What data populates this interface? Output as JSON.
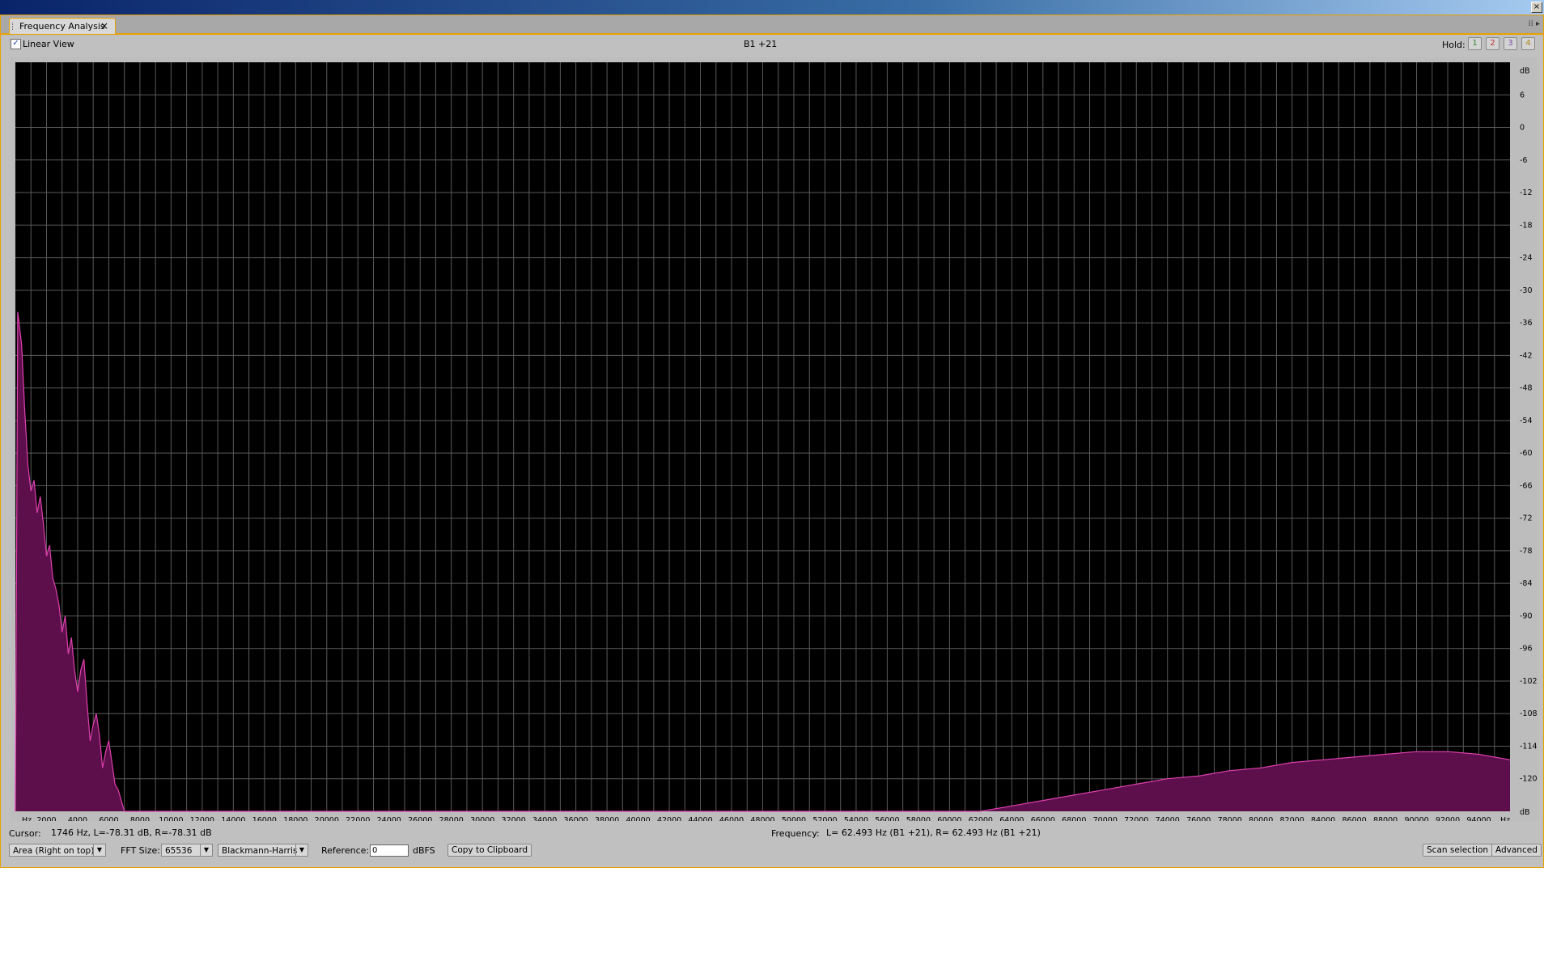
{
  "window": {
    "close_glyph": "×"
  },
  "tab": {
    "label": "Frequency Analysis",
    "close": "×",
    "strip_glyphs": "⁞⁞ ▸"
  },
  "toolbar": {
    "linear_view_checked": "✓",
    "linear_view_label": "Linear View",
    "center_label": "B1 +21",
    "hold_label": "Hold:",
    "hold_buttons": [
      {
        "label": "1",
        "color": "#3a8a3a"
      },
      {
        "label": "2",
        "color": "#c03030"
      },
      {
        "label": "3",
        "color": "#7a4aa0"
      },
      {
        "label": "4",
        "color": "#b08a20"
      }
    ]
  },
  "status": {
    "cursor_label": "Cursor:",
    "cursor_value": "1746 Hz, L=-78.31 dB, R=-78.31 dB",
    "frequency_label": "Frequency:",
    "frequency_value": "L= 62.493 Hz (B1 +21), R= 62.493 Hz (B1 +21)"
  },
  "controls": {
    "graph_mode": "Area (Right on top)",
    "fft_label": "FFT Size:",
    "fft_value": "65536",
    "window_value": "Blackmann-Harris",
    "reference_label": "Reference:",
    "reference_value": "0",
    "reference_unit": "dBFS",
    "copy_button": "Copy to Clipboard",
    "scan_button": "Scan selection",
    "advanced_button": "Advanced",
    "dropdown_arrow": "▼"
  },
  "chart_data": {
    "type": "area",
    "xlabel": "Hz",
    "ylabel": "dB",
    "xlim": [
      0,
      96000
    ],
    "ylim": [
      -126,
      12
    ],
    "x_ticks": [
      "2000",
      "4000",
      "6000",
      "8000",
      "10000",
      "12000",
      "14000",
      "16000",
      "18000",
      "20000",
      "22000",
      "24000",
      "26000",
      "28000",
      "30000",
      "32000",
      "34000",
      "36000",
      "38000",
      "40000",
      "42000",
      "44000",
      "46000",
      "48000",
      "50000",
      "52000",
      "54000",
      "56000",
      "58000",
      "60000",
      "62000",
      "64000",
      "66000",
      "68000",
      "70000",
      "72000",
      "74000",
      "76000",
      "78000",
      "80000",
      "82000",
      "84000",
      "86000",
      "88000",
      "90000",
      "92000",
      "94000"
    ],
    "x_tick_values": [
      2000,
      4000,
      6000,
      8000,
      10000,
      12000,
      14000,
      16000,
      18000,
      20000,
      22000,
      24000,
      26000,
      28000,
      30000,
      32000,
      34000,
      36000,
      38000,
      40000,
      42000,
      44000,
      46000,
      48000,
      50000,
      52000,
      54000,
      56000,
      58000,
      60000,
      62000,
      64000,
      66000,
      68000,
      70000,
      72000,
      74000,
      76000,
      78000,
      80000,
      82000,
      84000,
      86000,
      88000,
      90000,
      92000,
      94000
    ],
    "y_ticks": [
      "6",
      "0",
      "-6",
      "-12",
      "-18",
      "-24",
      "-30",
      "-36",
      "-42",
      "-48",
      "-54",
      "-60",
      "-66",
      "-72",
      "-78",
      "-84",
      "-90",
      "-96",
      "-102",
      "-108",
      "-114",
      "-120"
    ],
    "y_tick_values": [
      6,
      0,
      -6,
      -12,
      -18,
      -24,
      -30,
      -36,
      -42,
      -48,
      -54,
      -60,
      -66,
      -72,
      -78,
      -84,
      -90,
      -96,
      -102,
      -108,
      -114,
      -120
    ],
    "grid": true,
    "fill_color": "#5c0f4a",
    "line_color": "#e040b0",
    "series": [
      {
        "x": [
          0,
          150,
          400,
          600,
          800,
          1000,
          1200,
          1400,
          1600,
          1800,
          2000,
          2200,
          2400,
          2600,
          2800,
          3000,
          3200,
          3400,
          3600,
          3800,
          4000,
          4200,
          4400,
          4600,
          4800,
          5000,
          5200,
          5400,
          5600,
          5800,
          6000,
          6200,
          6400,
          6600,
          6800,
          7000,
          7200,
          7400,
          7600,
          7800,
          8000,
          8200,
          8400,
          8600,
          8800,
          9000,
          9200,
          9400,
          9600,
          9800,
          10000,
          60000,
          62000,
          64000,
          66000,
          68000,
          70000,
          72000,
          74000,
          76000,
          78000,
          80000,
          82000,
          84000,
          86000,
          88000,
          90000,
          91000,
          92000,
          94000,
          96000
        ],
        "y": [
          -126,
          -34,
          -40,
          -52,
          -62,
          -67,
          -65,
          -71,
          -68,
          -73,
          -79,
          -77,
          -83,
          -85,
          -88,
          -93,
          -90,
          -97,
          -94,
          -100,
          -104,
          -100,
          -98,
          -106,
          -113,
          -110,
          -108,
          -112,
          -118,
          -115,
          -113,
          -117,
          -121,
          -122,
          -124,
          -126,
          -126,
          -126,
          -126,
          -126,
          -126,
          -126,
          -126,
          -126,
          -126,
          -126,
          -126,
          -126,
          -126,
          -126,
          -126,
          -126,
          -126,
          -125,
          -124,
          -123,
          -122,
          -121,
          -120,
          -119.5,
          -118.5,
          -118,
          -117,
          -116.5,
          -116,
          -115.5,
          -115,
          -115,
          -115,
          -115.5,
          -116.5
        ]
      }
    ]
  }
}
